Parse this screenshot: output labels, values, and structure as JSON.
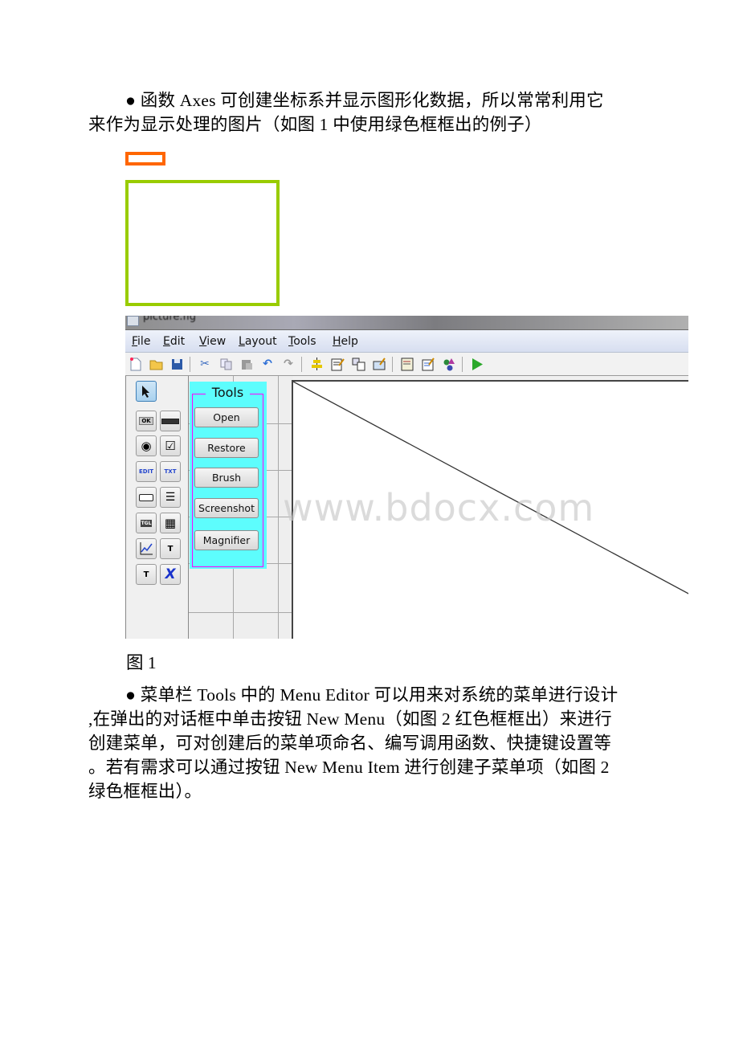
{
  "paragraph1": {
    "lines": [
      "● 函数 Axes 可创建坐标系并显示图形化数据，所以常常利用它",
      "来作为显示处理的图片（如图 1 中使用绿色框框出的例子）"
    ]
  },
  "legend_boxes": {
    "orange_color": "#ff6600",
    "green_color": "#99cc00"
  },
  "window": {
    "title": "picture.fig",
    "menu": [
      "File",
      "Edit",
      "View",
      "Layout",
      "Tools",
      "Help"
    ],
    "menu_mnemonics": [
      "F",
      "E",
      "V",
      "L",
      "T",
      "H"
    ],
    "toolbar_icons": [
      "new-file-icon",
      "open-folder-icon",
      "save-icon",
      "cut-icon",
      "copy-icon",
      "paste-icon",
      "undo-icon",
      "redo-icon",
      "align-icon",
      "menu-editor-icon",
      "tab-order-icon",
      "toolbar-editor-icon",
      "mfile-editor-icon",
      "property-inspector-icon",
      "object-browser-icon",
      "run-icon"
    ],
    "palette": [
      {
        "name": "select-tool",
        "glyph": "➤"
      },
      {
        "name": "push-button-tool",
        "glyph": "OK"
      },
      {
        "name": "slider-tool",
        "glyph": "▭"
      },
      {
        "name": "radio-button-tool",
        "glyph": "◉"
      },
      {
        "name": "checkbox-tool",
        "glyph": "☑"
      },
      {
        "name": "edit-text-tool",
        "glyph": "EDIT"
      },
      {
        "name": "static-text-tool",
        "glyph": "TXT"
      },
      {
        "name": "popup-menu-tool",
        "glyph": "▭"
      },
      {
        "name": "listbox-tool",
        "glyph": "☰"
      },
      {
        "name": "toggle-button-tool",
        "glyph": "TGL"
      },
      {
        "name": "table-tool",
        "glyph": "▦"
      },
      {
        "name": "axes-tool",
        "glyph": "📈"
      },
      {
        "name": "panel-tool",
        "glyph": "T"
      },
      {
        "name": "button-group-tool",
        "glyph": "T"
      },
      {
        "name": "activex-tool",
        "glyph": "X"
      }
    ],
    "tools_panel": {
      "title": "Tools",
      "buttons": [
        "Open",
        "Restore",
        "Brush",
        "Screenshot",
        "Magnifier"
      ],
      "background": "#5dfdfd",
      "border": "#ff00ff"
    }
  },
  "figure_caption": "图 1",
  "paragraph2": {
    "lines": [
      "● 菜单栏 Tools 中的 Menu Editor 可以用来对系统的菜单进行设计",
      ",在弹出的对话框中单击按钮 New Menu（如图 2 红色框框出）来进行",
      "创建菜单，可对创建后的菜单项命名、编写调用函数、快捷键设置等",
      "。若有需求可以通过按钮 New Menu Item 进行创建子菜单项（如图 2",
      "绿色框框出）。"
    ]
  },
  "watermark": "www.bdocx.com"
}
